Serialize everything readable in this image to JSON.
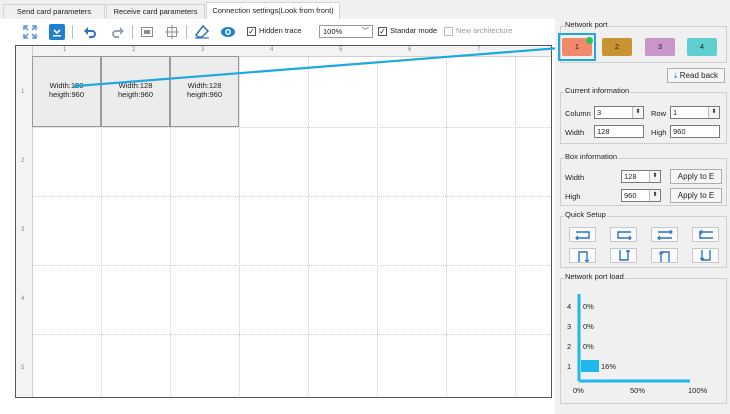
{
  "tabs": [
    {
      "label": "Send card parameters"
    },
    {
      "label": "Receive card parameters"
    },
    {
      "label": "Connection settings(Look from front)"
    }
  ],
  "toolbar": {
    "hidden_trace_label": "Hidden trace",
    "hidden_trace_checked": true,
    "zoom_value": "100%",
    "standard_mode_label": "Standar mode",
    "standard_mode_checked": true,
    "new_arch_label": "New architecture",
    "new_arch_checked": false
  },
  "canvas": {
    "ruler_top": [
      "1",
      "2",
      "3",
      "4",
      "5",
      "6",
      "7"
    ],
    "ruler_left": [
      "1",
      "2",
      "3",
      "4",
      "5"
    ],
    "cards": [
      {
        "line1": "Width:128",
        "line2": "heigth:960"
      },
      {
        "line1": "Width:128",
        "line2": "heigth:960"
      },
      {
        "line1": "Width:128",
        "line2": "heigth:960"
      }
    ]
  },
  "network_port": {
    "title": "Network port",
    "ports": [
      {
        "label": "1",
        "color": "#f08a6a"
      },
      {
        "label": "2",
        "color": "#c89432"
      },
      {
        "label": "3",
        "color": "#c996c9"
      },
      {
        "label": "4",
        "color": "#5fcfcf"
      }
    ],
    "selected_indicator_color": "#22c55e",
    "read_back_label": "Read back"
  },
  "current_info": {
    "title": "Current information",
    "column_label": "Column",
    "column_value": "3",
    "row_label": "Row",
    "row_value": "1",
    "width_label": "Width",
    "width_value": "128",
    "high_label": "High",
    "high_value": "960"
  },
  "box_info": {
    "title": "Box information",
    "width_label": "Width",
    "width_value": "128",
    "high_label": "High",
    "high_value": "960",
    "apply_label": "Apply to E"
  },
  "quick_setup": {
    "title": "Quick Setup"
  },
  "port_load": {
    "title": "Network port load",
    "ports": [
      {
        "label": "4",
        "value": "0%",
        "percent": 0
      },
      {
        "label": "3",
        "value": "0%",
        "percent": 0
      },
      {
        "label": "2",
        "value": "0%",
        "percent": 0
      },
      {
        "label": "1",
        "value": "16%",
        "percent": 16
      }
    ],
    "axis": [
      "0%",
      "50%",
      "100%"
    ],
    "bar_color": "#1fb8ec"
  }
}
